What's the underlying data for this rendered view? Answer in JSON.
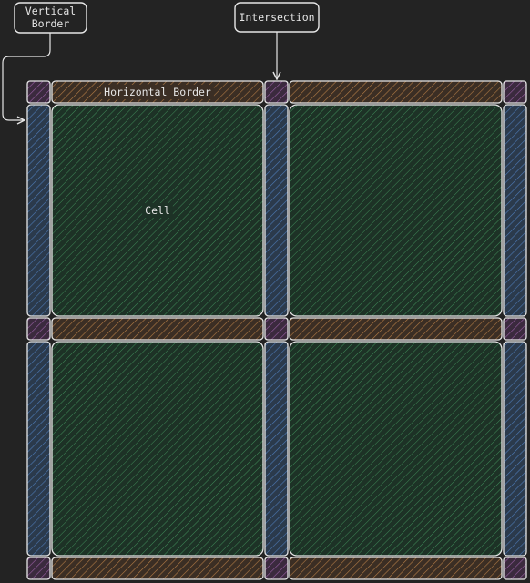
{
  "callouts": {
    "vertical_border": [
      "Vertical",
      "Border"
    ],
    "intersection": "Intersection"
  },
  "labels": {
    "horizontal_border": "Horizontal Border",
    "cell": "Cell"
  },
  "colors": {
    "background": "#232323",
    "stroke": "#e6e6e6",
    "vertical_border_fill": "#2b3a4c",
    "vertical_border_hatch": "#4d7ab5",
    "horizontal_border_fill": "#3b2e24",
    "horizontal_border_hatch": "#b07a45",
    "intersection_fill": "#3b2a3e",
    "intersection_hatch": "#9c62a8",
    "cell_fill": "#1d3226",
    "cell_hatch": "#3f8a58"
  }
}
